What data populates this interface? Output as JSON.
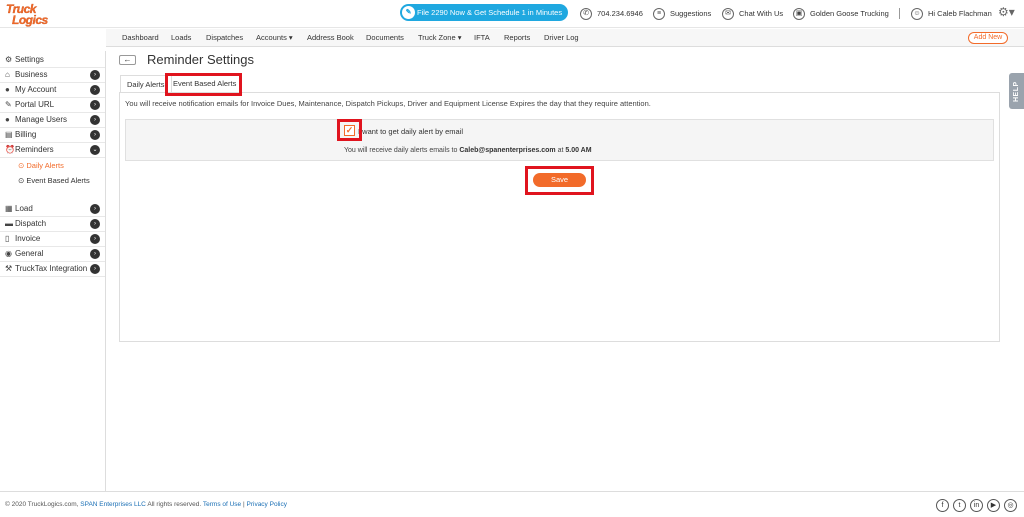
{
  "brand": {
    "line1": "Truck",
    "line2": "Logics"
  },
  "header": {
    "promo": "File 2290 Now & Get Schedule 1 in Minutes",
    "phone": "704.234.6946",
    "suggestions": "Suggestions",
    "chat": "Chat With Us",
    "company": "Golden Goose Trucking",
    "user": "Hi Caleb Flachman"
  },
  "nav": {
    "items": [
      "Dashboard",
      "Loads",
      "Dispatches",
      "Accounts ▾",
      "Address Book",
      "Documents",
      "Truck Zone ▾",
      "IFTA",
      "Reports",
      "Driver Log"
    ],
    "add_new": "Add New"
  },
  "sidebar": {
    "settings": "Settings",
    "items": [
      "Business",
      "My Account",
      "Portal URL",
      "Manage Users",
      "Billing",
      "Reminders"
    ],
    "sub_items": [
      "Daily Alerts",
      "Event Based Alerts"
    ],
    "items2": [
      "Load",
      "Dispatch",
      "Invoice",
      "General",
      "TruckTax Integration"
    ]
  },
  "page": {
    "title": "Reminder Settings",
    "tabs": [
      "Daily Alerts",
      "Event Based Alerts"
    ],
    "info": "You will receive notification emails for Invoice Dues, Maintenance, Dispatch Pickups, Driver and Equipment License Expires the day that they require attention.",
    "checkbox_label": "I want to get daily alert by email",
    "checkbox_checked": true,
    "alert_prefix": "You will receive daily alerts emails to",
    "alert_email": "Caleb@spanenterprises.com",
    "alert_mid": "at",
    "alert_time": "5.00 AM",
    "save": "Save",
    "help": "HELP"
  },
  "footer": {
    "copyright": "© 2020 TruckLogics.com,",
    "company": "SPAN Enterprises LLC",
    "rights": "All rights reserved.",
    "terms": "Terms of Use",
    "divider": "|",
    "privacy": "Privacy Policy"
  },
  "colors": {
    "accent": "#f26b2a",
    "promo": "#1fa8e0",
    "highlight": "#e0141e"
  }
}
